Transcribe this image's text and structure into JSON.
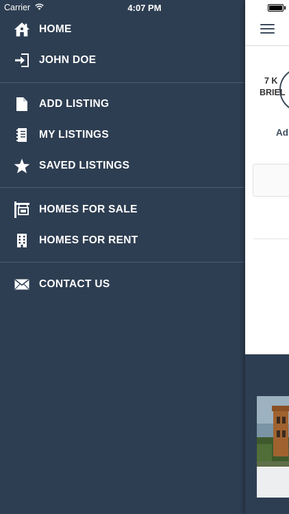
{
  "status_bar": {
    "carrier": "Carrier",
    "time": "4:07 PM"
  },
  "menu": {
    "items": [
      {
        "label": "HOME",
        "icon": "home-icon"
      },
      {
        "label": "JOHN DOE",
        "icon": "sign-in-icon"
      },
      {
        "label": "ADD LISTING",
        "icon": "document-icon"
      },
      {
        "label": "MY LISTINGS",
        "icon": "notebook-icon"
      },
      {
        "label": "SAVED LISTINGS",
        "icon": "star-icon"
      },
      {
        "label": "HOMES FOR SALE",
        "icon": "for-sale-sign-icon"
      },
      {
        "label": "HOMES FOR RENT",
        "icon": "building-icon"
      },
      {
        "label": "CONTACT US",
        "icon": "envelope-icon"
      }
    ]
  },
  "content": {
    "partial_label": "Ad",
    "card": {
      "line1": "7 K",
      "line2": "BRIEL"
    }
  },
  "colors": {
    "menu_bg": "#2e3e52",
    "separator": "#4d5e72",
    "content_bg": "#ffffff",
    "accent_dark": "#3b4a5c"
  }
}
